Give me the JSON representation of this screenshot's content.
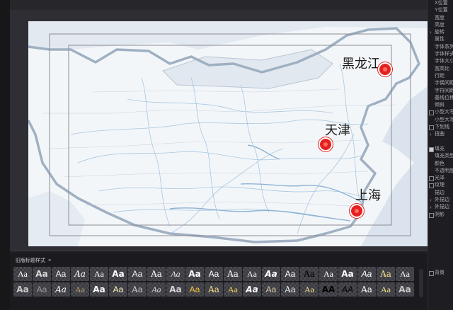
{
  "map": {
    "cities": [
      {
        "name": "黑龙江",
        "color": "#e4211f"
      },
      {
        "name": "天津",
        "color": "#e4211f"
      },
      {
        "name": "上海",
        "color": "#e4211f"
      }
    ],
    "colors": {
      "water": "#dbe4ee",
      "land": "#f3f6f9",
      "border": "#9fb0c2",
      "river": "#a7c7e0",
      "safe_frame": "#8c8c92"
    }
  },
  "properties_panel": {
    "items": [
      {
        "label": "X位置",
        "control": "none"
      },
      {
        "label": "Y位置",
        "control": "none"
      },
      {
        "label": "宽度",
        "control": "none"
      },
      {
        "label": "高度",
        "control": "none"
      },
      {
        "label": "旋转",
        "control": "arrow"
      },
      {
        "label": "属性",
        "control": "none"
      },
      {
        "label": "字体系列",
        "control": "none"
      },
      {
        "label": "字体样式",
        "control": "none"
      },
      {
        "label": "字体大小",
        "control": "none"
      },
      {
        "label": "宽高比",
        "control": "none"
      },
      {
        "label": "行距",
        "control": "none"
      },
      {
        "label": "字偶间距",
        "control": "none"
      },
      {
        "label": "字符间距",
        "control": "none"
      },
      {
        "label": "基线位移",
        "control": "none"
      },
      {
        "label": "倾斜",
        "control": "none"
      },
      {
        "label": "小型大写字母",
        "control": "check"
      },
      {
        "label": "小型大写字母尺寸",
        "control": "none"
      },
      {
        "label": "下划线",
        "control": "check"
      },
      {
        "label": "扭曲",
        "control": "arrow"
      },
      {
        "label": "",
        "control": "none"
      },
      {
        "label": "填充",
        "control": "checked"
      },
      {
        "label": "填充类型",
        "control": "none"
      },
      {
        "label": "颜色",
        "control": "none"
      },
      {
        "label": "不透明度",
        "control": "none"
      },
      {
        "label": "光泽",
        "control": "check"
      },
      {
        "label": "纹理",
        "control": "check"
      },
      {
        "label": "描边",
        "control": "none"
      },
      {
        "label": "外描边",
        "control": "arrow"
      },
      {
        "label": "外描边",
        "control": "arrow"
      },
      {
        "label": "阴影",
        "control": "check"
      },
      {
        "label": "",
        "control": "none"
      },
      {
        "label": "",
        "control": "none"
      },
      {
        "label": "",
        "control": "none"
      },
      {
        "label": "",
        "control": "none"
      },
      {
        "label": "",
        "control": "none"
      },
      {
        "label": "",
        "control": "none"
      },
      {
        "label": "",
        "control": "none"
      },
      {
        "label": "背景",
        "control": "check"
      },
      {
        "label": "",
        "control": "none"
      },
      {
        "label": "",
        "control": "none"
      }
    ]
  },
  "styles_panel": {
    "title": "旧版标题样式",
    "menu_glyph": "≡",
    "swatches": [
      {
        "label": "Aa",
        "color": "#ffffff"
      },
      {
        "label": "Aa",
        "color": "#d9d9d9"
      },
      {
        "label": "Aa",
        "color": "#f2f2f2"
      },
      {
        "label": "Aa",
        "color": "#ffffff"
      },
      {
        "label": "Aa",
        "color": "#ffffff"
      },
      {
        "label": "Aa",
        "color": "#ffffff"
      },
      {
        "label": "Aa",
        "color": "#f0f0f0"
      },
      {
        "label": "Aa",
        "color": "#ffffff"
      },
      {
        "label": "Aa",
        "color": "#e5e5e5"
      },
      {
        "label": "Aa",
        "color": "#ffffff"
      },
      {
        "label": "Aa",
        "color": "#ffffff"
      },
      {
        "label": "Aa",
        "color": "#ffffff"
      },
      {
        "label": "Aa",
        "color": "#f5f5f5"
      },
      {
        "label": "Aa",
        "color": "#ffffff"
      },
      {
        "label": "Aa",
        "color": "#ffffff"
      },
      {
        "label": "Aa",
        "color": "#000000"
      },
      {
        "label": "Aa",
        "color": "#ffffff"
      },
      {
        "label": "Aa",
        "color": "#ffffff"
      },
      {
        "label": "Aa",
        "color": "#ffffff"
      },
      {
        "label": "Aa",
        "color": "#f3e08a"
      },
      {
        "label": "Aa",
        "color": "#ffffff"
      },
      {
        "label": "Aa",
        "color": "#c9c9c9"
      },
      {
        "label": "Aa",
        "color": "#9a9a9a"
      },
      {
        "label": "Aa",
        "color": "#ffffff"
      },
      {
        "label": "Aa",
        "color": "#b8a06a"
      },
      {
        "label": "Aa",
        "color": "#ffffff"
      },
      {
        "label": "Aa",
        "color": "#fff2b3"
      },
      {
        "label": "Aa",
        "color": "#c9c9c9"
      },
      {
        "label": "Aa",
        "color": "#d9d9d9"
      },
      {
        "label": "Aa",
        "color": "#d5d5d5"
      },
      {
        "label": "Aa",
        "color": "#f3c13a"
      },
      {
        "label": "Aa",
        "color": "#f3e08a"
      },
      {
        "label": "Aa",
        "color": "#f7d25a"
      },
      {
        "label": "Aa",
        "color": "#ffffff"
      },
      {
        "label": "Aa",
        "color": "#d8c9a0"
      },
      {
        "label": "Aa",
        "color": "#e8e8e8"
      },
      {
        "label": "Aa",
        "color": "#f3e08a"
      },
      {
        "label": "AA",
        "color": "#000000"
      },
      {
        "label": "AA",
        "color": "#000000"
      },
      {
        "label": "Aa",
        "color": "#ffffff"
      },
      {
        "label": "Aa",
        "color": "#f3e08a"
      },
      {
        "label": "Aa",
        "color": "#c9c9c9"
      }
    ]
  }
}
